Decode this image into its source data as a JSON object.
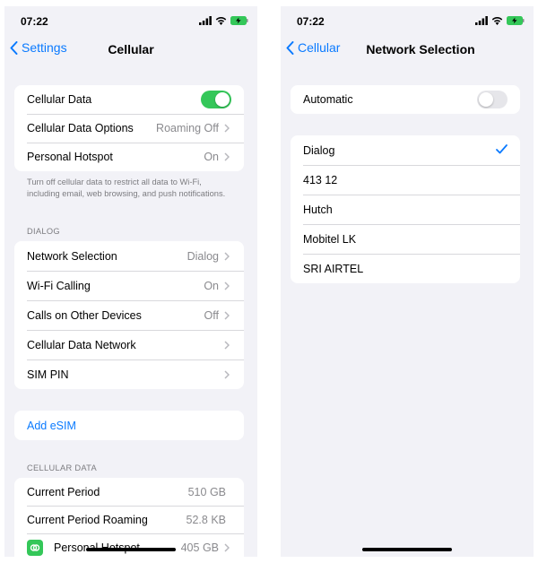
{
  "left": {
    "status": {
      "time": "07:22"
    },
    "nav": {
      "back_label": "Settings",
      "title": "Cellular"
    },
    "top_group": [
      {
        "label": "Cellular Data",
        "toggle": "on"
      },
      {
        "label": "Cellular Data Options",
        "value": "Roaming Off"
      },
      {
        "label": "Personal Hotspot",
        "value": "On"
      }
    ],
    "footnote": "Turn off cellular data to restrict all data to Wi-Fi, including email, web browsing, and push notifications.",
    "dialog_header": "DIALOG",
    "dialog_group": [
      {
        "label": "Network Selection",
        "value": "Dialog"
      },
      {
        "label": "Wi-Fi Calling",
        "value": "On"
      },
      {
        "label": "Calls on Other Devices",
        "value": "Off"
      },
      {
        "label": "Cellular Data Network",
        "value": ""
      },
      {
        "label": "SIM PIN",
        "value": ""
      }
    ],
    "add_esim": "Add eSIM",
    "usage_header": "CELLULAR DATA",
    "usage_group": [
      {
        "label": "Current Period",
        "value": "510 GB"
      },
      {
        "label": "Current Period Roaming",
        "value": "52.8 KB"
      },
      {
        "label": "Personal Hotspot",
        "value": "405 GB"
      }
    ]
  },
  "right": {
    "status": {
      "time": "07:22"
    },
    "nav": {
      "back_label": "Cellular",
      "title": "Network Selection"
    },
    "automatic": {
      "label": "Automatic",
      "toggle": "off"
    },
    "networks": [
      "Dialog",
      "413 12",
      "Hutch",
      "Mobitel LK",
      "SRI AIRTEL"
    ],
    "selected_network": "Dialog"
  },
  "colors": {
    "accent": "#0a7aff",
    "toggle_on": "#34c759",
    "background": "#f2f2f7"
  }
}
